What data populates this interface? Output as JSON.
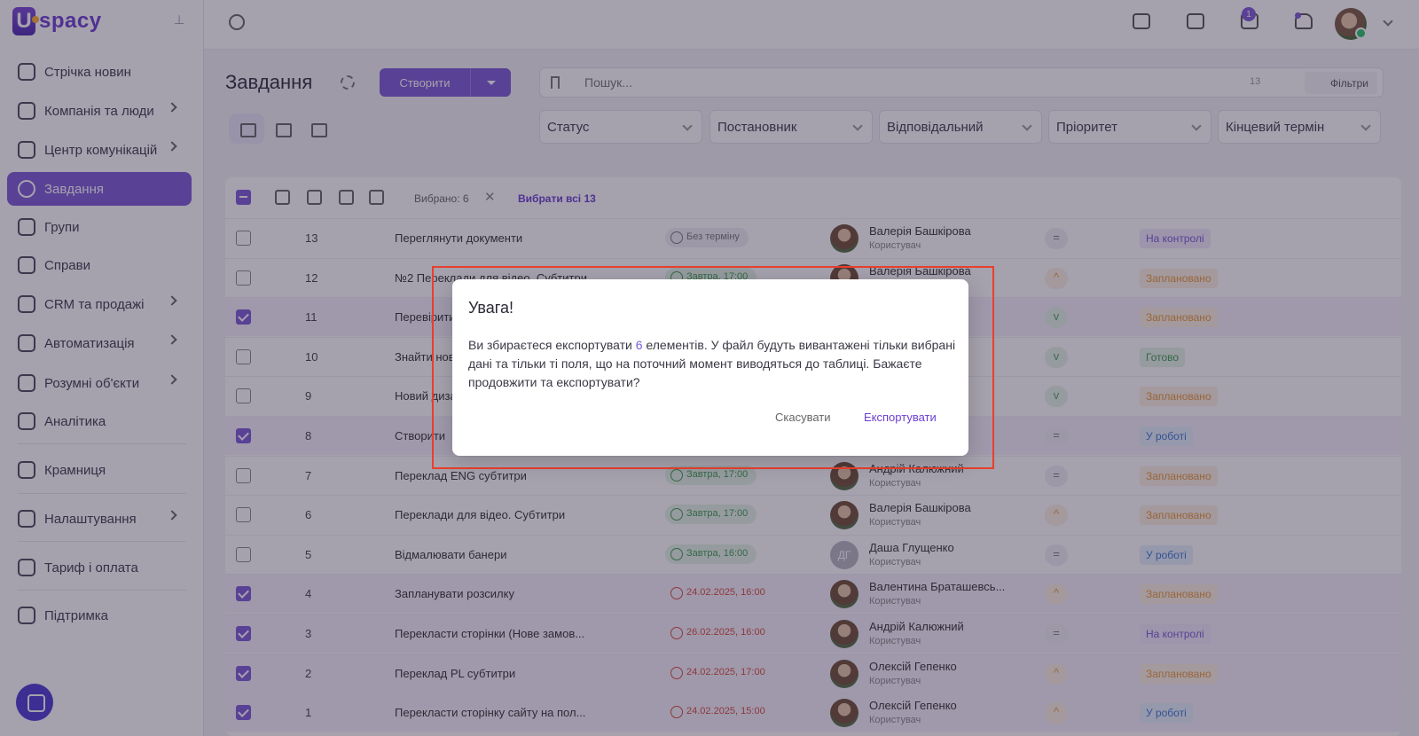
{
  "app": {
    "logo_text": "spacy"
  },
  "sidebar": {
    "items": [
      {
        "label": "Стрічка новин",
        "icon": "home-icon"
      },
      {
        "label": "Компанія та люди",
        "icon": "building-icon"
      },
      {
        "label": "Центр комунікацій",
        "icon": "chat-icon"
      },
      {
        "label": "Завдання",
        "icon": "check-circle-icon"
      },
      {
        "label": "Групи",
        "icon": "users-icon"
      },
      {
        "label": "Справи",
        "icon": "calendar-icon"
      },
      {
        "label": "CRM та продажі",
        "icon": "database-icon"
      },
      {
        "label": "Автоматизація",
        "icon": "lightning-icon"
      },
      {
        "label": "Розумні об'єкти",
        "icon": "smart-object-icon"
      },
      {
        "label": "Аналітика",
        "icon": "chart-icon"
      },
      {
        "label": "Крамниця",
        "icon": "store-icon"
      },
      {
        "label": "Налаштування",
        "icon": "gear-icon"
      },
      {
        "label": "Тариф і оплата",
        "icon": "wallet-icon"
      },
      {
        "label": "Підтримка",
        "icon": "help-icon"
      }
    ]
  },
  "topbar": {
    "mail_badge": "1"
  },
  "header": {
    "title": "Завдання",
    "create_label": "Створити",
    "search_placeholder": "Пошук...",
    "search_count": "13",
    "filters_label": "Фільтри"
  },
  "filters": [
    "Статус",
    "Постановник",
    "Відповідальний",
    "Пріоритет",
    "Кінцевий термін"
  ],
  "toolbar": {
    "selected_label": "Вибрано: 6",
    "select_all_label": "Вибрати всі 13"
  },
  "rows": [
    {
      "num": "13",
      "title": "Переглянути документи",
      "deadline": "Без терміну",
      "deadline_type": "none",
      "user": "Валерія Башкірова",
      "role": "Користувач",
      "priority": "=",
      "priority_type": "norm",
      "status": "На контролі",
      "status_type": "control",
      "checked": false
    },
    {
      "num": "12",
      "title": "№2 Переклади для відео. Субтитри",
      "deadline": "Завтра, 17:00",
      "deadline_type": "ok",
      "user": "Валерія Башкірова",
      "role": "Користувач",
      "priority": "^",
      "priority_type": "high",
      "status": "Заплановано",
      "status_type": "planned",
      "checked": false
    },
    {
      "num": "11",
      "title": "Перевірити",
      "deadline": "",
      "deadline_type": "none",
      "user": "",
      "role": "",
      "priority": "v",
      "priority_type": "low",
      "status": "Заплановано",
      "status_type": "planned",
      "checked": true
    },
    {
      "num": "10",
      "title": "Знайти нові",
      "deadline": "",
      "deadline_type": "none",
      "user": "",
      "role": "",
      "priority": "v",
      "priority_type": "low",
      "status": "Готово",
      "status_type": "done",
      "checked": false
    },
    {
      "num": "9",
      "title": "Новий дизайн",
      "deadline": "",
      "deadline_type": "none",
      "user": "",
      "role": "",
      "priority": "v",
      "priority_type": "low",
      "status": "Заплановано",
      "status_type": "planned",
      "checked": false
    },
    {
      "num": "8",
      "title": "Створити",
      "deadline": "",
      "deadline_type": "none",
      "user": "",
      "role": "",
      "priority": "=",
      "priority_type": "norm",
      "status": "У роботі",
      "status_type": "work",
      "checked": true
    },
    {
      "num": "7",
      "title": "Переклад ENG субтитри",
      "deadline": "Завтра, 17:00",
      "deadline_type": "ok",
      "user": "Андрій Калюжний",
      "role": "Користувач",
      "priority": "=",
      "priority_type": "norm",
      "status": "Заплановано",
      "status_type": "planned",
      "checked": false
    },
    {
      "num": "6",
      "title": "Переклади для відео. Субтитри",
      "deadline": "Завтра, 17:00",
      "deadline_type": "ok",
      "user": "Валерія Башкірова",
      "role": "Користувач",
      "priority": "^",
      "priority_type": "high",
      "status": "Заплановано",
      "status_type": "planned",
      "checked": false
    },
    {
      "num": "5",
      "title": "Відмалювати банери",
      "deadline": "Завтра, 16:00",
      "deadline_type": "ok",
      "user": "Даша Глущенко",
      "role": "Користувач",
      "initials": "ДГ",
      "priority": "=",
      "priority_type": "norm",
      "status": "У роботі",
      "status_type": "work",
      "checked": false
    },
    {
      "num": "4",
      "title": "Запланувати розсилку",
      "deadline": "24.02.2025, 16:00",
      "deadline_type": "late",
      "user": "Валентина Браташевсь...",
      "role": "Користувач",
      "priority": "^",
      "priority_type": "high",
      "status": "Заплановано",
      "status_type": "planned",
      "checked": true
    },
    {
      "num": "3",
      "title": "Перекласти сторінки (Нове замов...",
      "deadline": "26.02.2025, 16:00",
      "deadline_type": "late",
      "user": "Андрій Калюжний",
      "role": "Користувач",
      "priority": "=",
      "priority_type": "norm",
      "status": "На контролі",
      "status_type": "control",
      "checked": true
    },
    {
      "num": "2",
      "title": "Переклад PL субтитри",
      "deadline": "24.02.2025, 17:00",
      "deadline_type": "late",
      "user": "Олексій Гепенко",
      "role": "Користувач",
      "priority": "^",
      "priority_type": "high",
      "status": "Заплановано",
      "status_type": "planned",
      "checked": true
    },
    {
      "num": "1",
      "title": "Перекласти сторінку сайту на пол...",
      "deadline": "24.02.2025, 15:00",
      "deadline_type": "late",
      "user": "Олексій Гепенко",
      "role": "Користувач",
      "priority": "^",
      "priority_type": "high",
      "status": "У роботі",
      "status_type": "work",
      "checked": true
    }
  ],
  "modal": {
    "title": "Увага!",
    "body_before": "Ви збираєтеся експортувати ",
    "body_count": "6",
    "body_after": " елементів. У файл будуть вивантажені тільки вибрані дані та тільки ті поля, що на поточний момент виводяться до таблиці. Бажаєте продовжити та експортувати?",
    "cancel_label": "Скасувати",
    "export_label": "Експортувати"
  }
}
